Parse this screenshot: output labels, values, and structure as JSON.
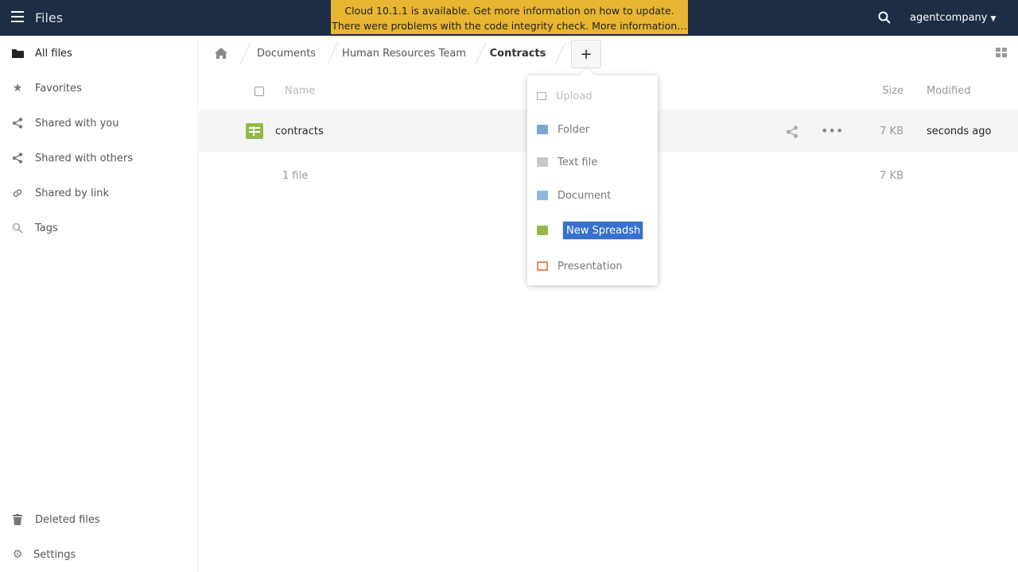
{
  "header": {
    "app_name": "Files",
    "notice_line1": "Cloud 10.1.1 is available. Get more information on how to update.",
    "notice_line2": "There were problems with the code integrity check. More information…",
    "user": "agentcompany",
    "colors": {
      "header_bg": "#1d2d44",
      "notice_bg": "#e8b530"
    }
  },
  "sidebar": {
    "items": [
      {
        "label": "All files",
        "icon": "folder-icon"
      },
      {
        "label": "Favorites",
        "icon": "star-icon"
      },
      {
        "label": "Shared with you",
        "icon": "share-icon"
      },
      {
        "label": "Shared with others",
        "icon": "share-icon"
      },
      {
        "label": "Shared by link",
        "icon": "link-icon"
      },
      {
        "label": "Tags",
        "icon": "tag-icon"
      }
    ],
    "deleted_label": "Deleted files",
    "settings_label": "Settings"
  },
  "breadcrumb": {
    "items": [
      "Documents",
      "Human Resources Team",
      "Contracts"
    ]
  },
  "table": {
    "col_name": "Name",
    "col_size": "Size",
    "col_modified": "Modified",
    "rows": [
      {
        "name": "contracts",
        "ext": "",
        "size": "7 KB",
        "modified": "seconds ago"
      }
    ],
    "summary_count": "1 file",
    "summary_size": "7 KB"
  },
  "new_menu": {
    "upload": "Upload",
    "folder": "Folder",
    "text_file": "Text file",
    "document": "Document",
    "spreadsheet_input_value": "New Spreadsheet",
    "presentation": "Presentation"
  }
}
